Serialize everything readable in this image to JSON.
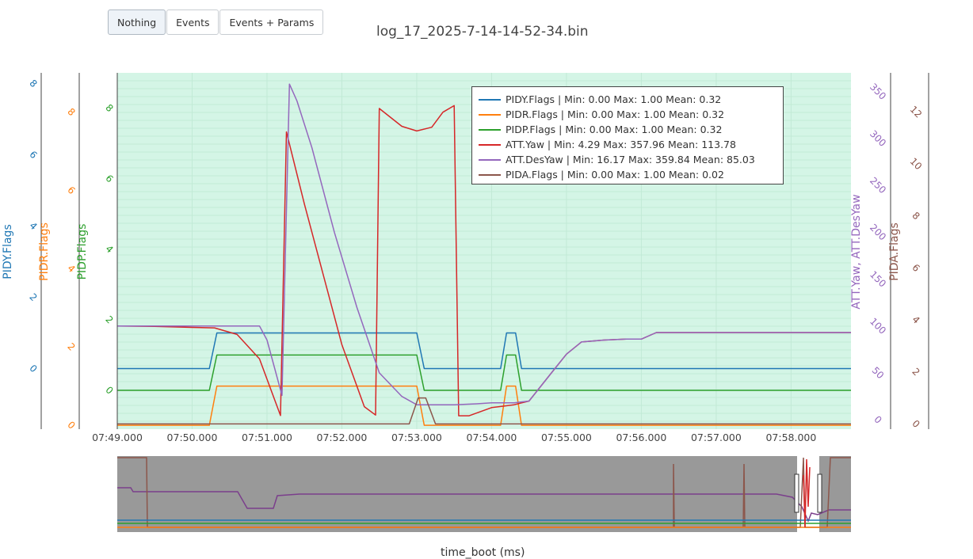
{
  "toolbar": {
    "buttons": [
      {
        "label": "Nothing",
        "active": true
      },
      {
        "label": "Events",
        "active": false
      },
      {
        "label": "Events + Params",
        "active": false
      }
    ]
  },
  "chart_title": "log_17_2025-7-14-14-52-34.bin",
  "colors": {
    "plot_background": "#d4f5e6",
    "navigator_background": "#999999",
    "PIDY": "#1f77b4",
    "PIDR": "#ff7f0e",
    "PIDP": "#2ca02c",
    "ATT_Yaw": "#d62728",
    "ATT_DesYaw": "#9467bd",
    "PIDA": "#8c564b"
  },
  "chart_data": {
    "type": "line",
    "xlabel": "time_boot (ms)",
    "x_ticks": [
      "07:49.000",
      "07:50.000",
      "07:51.000",
      "07:52.000",
      "07:53.000",
      "07:54.000",
      "07:55.000",
      "07:56.000",
      "07:57.000",
      "07:58.000"
    ],
    "xlim": [
      "07:49.000",
      "07:58.800"
    ],
    "grid": true,
    "legend_position": "top-right",
    "axes": [
      {
        "id": "pidy",
        "label": "PIDY.Flags",
        "color": "#1f77b4",
        "range": [
          -1.7,
          8.3
        ],
        "ticks": [
          0,
          2,
          4,
          6,
          8
        ]
      },
      {
        "id": "pidr",
        "label": "PIDR.Flags",
        "color": "#ff7f0e",
        "range": [
          -0.1,
          9.0
        ],
        "ticks": [
          0,
          2,
          4,
          6,
          8
        ]
      },
      {
        "id": "pidp",
        "label": "PIDP.Flags",
        "color": "#2ca02c",
        "range": [
          -1.1,
          9.0
        ],
        "ticks": [
          0,
          2,
          4,
          6,
          8
        ]
      },
      {
        "id": "att",
        "label": "ATT.Yaw, ATT.DesYaw",
        "color": "#9467bd",
        "range": [
          -10,
          370
        ],
        "ticks": [
          0,
          50,
          100,
          150,
          200,
          250,
          300,
          350
        ]
      },
      {
        "id": "pida",
        "label": "PIDA.Flags",
        "color": "#8c564b",
        "range": [
          -0.2,
          13.5
        ],
        "ticks": [
          0,
          2,
          4,
          6,
          8,
          10,
          12
        ]
      }
    ],
    "legend": [
      "PIDY.Flags | Min: 0.00     Max: 1.00     Mean: 0.32",
      "PIDR.Flags | Min: 0.00     Max: 1.00     Mean: 0.32",
      "PIDP.Flags | Min: 0.00     Max: 1.00     Mean: 0.32",
      "ATT.Yaw | Min: 4.29     Max: 357.96     Mean: 113.78",
      "ATT.DesYaw | Min: 16.17     Max: 359.84     Mean: 85.03",
      "PIDA.Flags | Min: 0.00     Max: 1.00     Mean: 0.02"
    ],
    "series": [
      {
        "name": "PIDY.Flags",
        "axis": "pidy",
        "color": "#1f77b4",
        "x": [
          49.0,
          50.23,
          50.33,
          53.0,
          53.1,
          54.12,
          54.2,
          54.32,
          54.4,
          58.8
        ],
        "y": [
          0,
          0,
          1,
          1,
          0,
          0,
          1,
          1,
          0,
          0
        ]
      },
      {
        "name": "PIDR.Flags",
        "axis": "pidr",
        "color": "#ff7f0e",
        "x": [
          49.0,
          50.23,
          50.33,
          53.0,
          53.1,
          54.12,
          54.2,
          54.32,
          54.4,
          58.8
        ],
        "y": [
          0,
          0,
          1,
          1,
          0,
          0,
          1,
          1,
          0,
          0
        ]
      },
      {
        "name": "PIDP.Flags",
        "axis": "pidp",
        "color": "#2ca02c",
        "x": [
          49.0,
          50.23,
          50.33,
          53.0,
          53.1,
          54.12,
          54.2,
          54.32,
          54.4,
          58.8
        ],
        "y": [
          0,
          0,
          1,
          1,
          0,
          0,
          1,
          1,
          0,
          0
        ]
      },
      {
        "name": "ATT.Yaw",
        "axis": "att",
        "color": "#d62728",
        "x": [
          49.0,
          49.5,
          50.0,
          50.3,
          50.6,
          50.9,
          51.18,
          51.26,
          51.5,
          51.8,
          52.0,
          52.3,
          52.45,
          52.5,
          52.8,
          53.0,
          53.2,
          53.35,
          53.5,
          53.56,
          53.7,
          54.0,
          54.3,
          54.5,
          54.8,
          55.0,
          55.2,
          55.5,
          55.8,
          56.0,
          56.2,
          56.5,
          57.0,
          57.5,
          58.0,
          58.8
        ],
        "y": [
          100,
          99.5,
          98.5,
          98,
          91,
          65,
          4.5,
          307,
          230,
          140,
          80,
          14,
          5,
          332,
          313,
          308,
          312,
          328,
          335,
          4.3,
          4.3,
          13,
          16,
          20,
          50,
          70,
          83,
          85,
          86,
          86,
          93,
          93,
          93,
          93,
          93,
          93
        ]
      },
      {
        "name": "ATT.DesYaw",
        "axis": "att",
        "color": "#9467bd",
        "x": [
          49.0,
          49.5,
          50.0,
          50.5,
          50.9,
          51.0,
          51.2,
          51.3,
          51.4,
          51.6,
          51.9,
          52.2,
          52.5,
          52.8,
          53.0,
          53.3,
          53.5,
          53.8,
          54.0,
          54.3,
          54.5,
          54.8,
          55.0,
          55.2,
          55.5,
          55.8,
          56.0,
          56.2,
          56.5,
          57.0,
          57.5,
          58.0,
          58.8
        ],
        "y": [
          100,
          100,
          100,
          100,
          100,
          85,
          26,
          358,
          340,
          290,
          200,
          120,
          50,
          25,
          16,
          16,
          16,
          17,
          18,
          18,
          20,
          50,
          70,
          83,
          85,
          86,
          86,
          93,
          93,
          93,
          93,
          93,
          93
        ]
      },
      {
        "name": "PIDA.Flags",
        "axis": "pida",
        "color": "#8c564b",
        "x": [
          49.0,
          52.9,
          53.02,
          53.12,
          53.25,
          58.8
        ],
        "y": [
          0,
          0,
          1,
          1,
          0,
          0
        ]
      }
    ]
  }
}
